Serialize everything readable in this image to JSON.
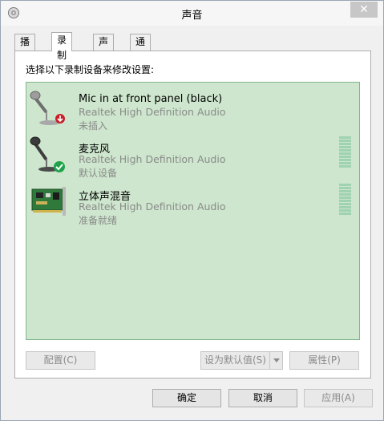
{
  "window": {
    "title": "声音",
    "close_glyph": "✕"
  },
  "tabs": [
    {
      "label": "播放",
      "active": false
    },
    {
      "label": "录制",
      "active": true
    },
    {
      "label": "声音",
      "active": false
    },
    {
      "label": "通信",
      "active": false
    }
  ],
  "panel": {
    "instruction": "选择以下录制设备来修改设置:"
  },
  "devices": [
    {
      "name": "Mic in at front panel (black)",
      "driver": "Realtek High Definition Audio",
      "status": "未插入",
      "icon": "microphone-unplugged-icon",
      "meter_visible": false
    },
    {
      "name": "麦克风",
      "driver": "Realtek High Definition Audio",
      "status": "默认设备",
      "icon": "microphone-default-icon",
      "meter_visible": true
    },
    {
      "name": "立体声混音",
      "driver": "Realtek High Definition Audio",
      "status": "准备就绪",
      "icon": "sound-card-icon",
      "meter_visible": true
    }
  ],
  "buttons": {
    "configure": "配置(C)",
    "set_default": "设为默认值(S)",
    "properties": "属性(P)",
    "ok": "确定",
    "cancel": "取消",
    "apply": "应用(A)"
  },
  "colors": {
    "list_background": "#cde6cd",
    "list_border": "#82b58c",
    "default_check": "#1fa34a",
    "unplugged_badge": "#c8202a"
  }
}
